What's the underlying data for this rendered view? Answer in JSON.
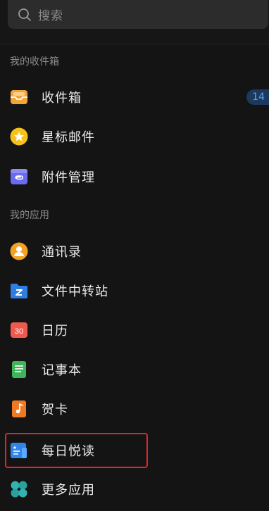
{
  "search": {
    "placeholder": "搜索",
    "icon": "search-icon"
  },
  "sections": {
    "mailbox_header": "我的收件箱",
    "apps_header": "我的应用"
  },
  "mailbox_items": [
    {
      "label": "收件箱",
      "icon": "inbox-icon",
      "icon_color": "#f2a43a",
      "badge": "14"
    },
    {
      "label": "星标邮件",
      "icon": "star-icon",
      "icon_color": "#f5c21b"
    },
    {
      "label": "附件管理",
      "icon": "attachment-icon",
      "icon_color": "#6a6cf0"
    }
  ],
  "app_items": [
    {
      "label": "通讯录",
      "icon": "contacts-icon",
      "icon_color": "#f4a224"
    },
    {
      "label": "文件中转站",
      "icon": "folder-icon",
      "icon_color": "#2f7de1"
    },
    {
      "label": "日历",
      "icon": "calendar-icon",
      "icon_color": "#ef5a4f",
      "icon_text": "30"
    },
    {
      "label": "记事本",
      "icon": "notebook-icon",
      "icon_color": "#3fb45a"
    },
    {
      "label": "贺卡",
      "icon": "greeting-card-icon",
      "icon_color": "#f07a24"
    },
    {
      "label": "每日悦读",
      "icon": "daily-reading-icon",
      "icon_color": "#2f86e8",
      "highlighted": true
    },
    {
      "label": "更多应用",
      "icon": "more-apps-icon",
      "icon_color": "#35b2b0"
    }
  ],
  "colors": {
    "background": "#141414",
    "highlight_border": "#e0262b",
    "badge_bg": "#1c3a5e",
    "badge_text": "#5aa0ea"
  }
}
